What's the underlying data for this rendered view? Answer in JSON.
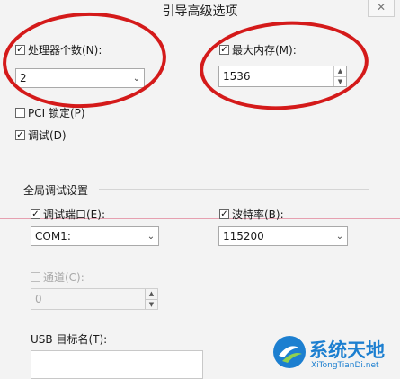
{
  "dialog": {
    "title": "引导高级选项"
  },
  "processors": {
    "label": "处理器个数(N):",
    "checked": true,
    "value": "2"
  },
  "max_memory": {
    "label": "最大内存(M):",
    "checked": true,
    "value": "1536"
  },
  "pci_lock": {
    "label": "PCI 锁定(P)",
    "checked": false
  },
  "debug": {
    "label": "调试(D)",
    "checked": true
  },
  "global_debug": {
    "section_title": "全局调试设置",
    "debug_port": {
      "label": "调试端口(E):",
      "checked": true,
      "value": "COM1:"
    },
    "baud_rate": {
      "label": "波特率(B):",
      "checked": true,
      "value": "115200"
    },
    "channel": {
      "label": "通道(C):",
      "checked": false,
      "value": "0"
    },
    "usb_target": {
      "label": "USB 目标名(T):"
    }
  },
  "watermark": {
    "text": "系统天地",
    "url": "XiTongTianDi.net"
  },
  "colors": {
    "annotation_red": "#d41a1a",
    "watermark_blue": "#1c7fd0"
  }
}
